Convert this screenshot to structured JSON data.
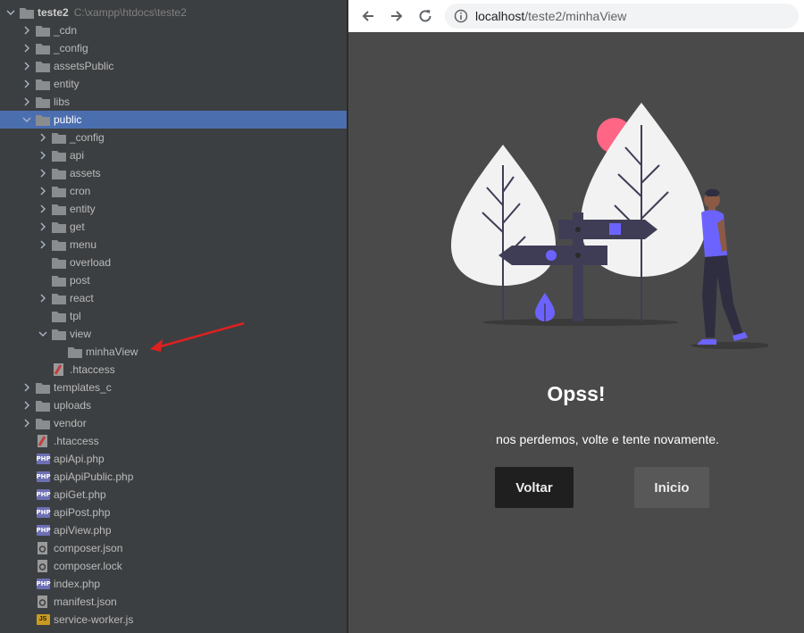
{
  "project_tree": {
    "root": {
      "name": "teste2",
      "path": "C:\\xampp\\htdocs\\teste2"
    },
    "items": [
      {
        "label": "_cdn",
        "depth": 1,
        "kind": "folder",
        "arrow": "collapsed"
      },
      {
        "label": "_config",
        "depth": 1,
        "kind": "folder",
        "arrow": "collapsed"
      },
      {
        "label": "assetsPublic",
        "depth": 1,
        "kind": "folder",
        "arrow": "collapsed"
      },
      {
        "label": "entity",
        "depth": 1,
        "kind": "folder",
        "arrow": "collapsed"
      },
      {
        "label": "libs",
        "depth": 1,
        "kind": "folder",
        "arrow": "collapsed"
      },
      {
        "label": "public",
        "depth": 1,
        "kind": "folder",
        "arrow": "expanded",
        "selected": true
      },
      {
        "label": "_config",
        "depth": 2,
        "kind": "folder",
        "arrow": "collapsed"
      },
      {
        "label": "api",
        "depth": 2,
        "kind": "folder",
        "arrow": "collapsed"
      },
      {
        "label": "assets",
        "depth": 2,
        "kind": "folder",
        "arrow": "collapsed"
      },
      {
        "label": "cron",
        "depth": 2,
        "kind": "folder",
        "arrow": "collapsed"
      },
      {
        "label": "entity",
        "depth": 2,
        "kind": "folder",
        "arrow": "collapsed"
      },
      {
        "label": "get",
        "depth": 2,
        "kind": "folder",
        "arrow": "collapsed"
      },
      {
        "label": "menu",
        "depth": 2,
        "kind": "folder",
        "arrow": "collapsed"
      },
      {
        "label": "overload",
        "depth": 2,
        "kind": "folder",
        "arrow": "none"
      },
      {
        "label": "post",
        "depth": 2,
        "kind": "folder",
        "arrow": "none"
      },
      {
        "label": "react",
        "depth": 2,
        "kind": "folder",
        "arrow": "collapsed"
      },
      {
        "label": "tpl",
        "depth": 2,
        "kind": "folder",
        "arrow": "none"
      },
      {
        "label": "view",
        "depth": 2,
        "kind": "folder",
        "arrow": "expanded"
      },
      {
        "label": "minhaView",
        "depth": 3,
        "kind": "folder",
        "arrow": "none"
      },
      {
        "label": ".htaccess",
        "depth": 2,
        "kind": "htaccess",
        "arrow": "none"
      },
      {
        "label": "templates_c",
        "depth": 1,
        "kind": "folder",
        "arrow": "collapsed"
      },
      {
        "label": "uploads",
        "depth": 1,
        "kind": "folder",
        "arrow": "collapsed"
      },
      {
        "label": "vendor",
        "depth": 1,
        "kind": "folder",
        "arrow": "collapsed"
      },
      {
        "label": ".htaccess",
        "depth": 1,
        "kind": "htaccess",
        "arrow": "none"
      },
      {
        "label": "apiApi.php",
        "depth": 1,
        "kind": "php",
        "arrow": "none"
      },
      {
        "label": "apiApiPublic.php",
        "depth": 1,
        "kind": "php",
        "arrow": "none"
      },
      {
        "label": "apiGet.php",
        "depth": 1,
        "kind": "php",
        "arrow": "none"
      },
      {
        "label": "apiPost.php",
        "depth": 1,
        "kind": "php",
        "arrow": "none"
      },
      {
        "label": "apiView.php",
        "depth": 1,
        "kind": "php",
        "arrow": "none"
      },
      {
        "label": "composer.json",
        "depth": 1,
        "kind": "json",
        "arrow": "none"
      },
      {
        "label": "composer.lock",
        "depth": 1,
        "kind": "json",
        "arrow": "none"
      },
      {
        "label": "index.php",
        "depth": 1,
        "kind": "php",
        "arrow": "none"
      },
      {
        "label": "manifest.json",
        "depth": 1,
        "kind": "json",
        "arrow": "none"
      },
      {
        "label": "service-worker.js",
        "depth": 1,
        "kind": "js",
        "arrow": "none"
      }
    ],
    "icon_labels": {
      "php": "PHP",
      "js": "JS"
    }
  },
  "browser": {
    "nav": {
      "back_icon": "arrow-left-icon",
      "forward_icon": "arrow-right-icon",
      "reload_icon": "reload-icon"
    },
    "url": {
      "host": "localhost",
      "path": "/teste2/minhaView"
    }
  },
  "page": {
    "title": "Opss!",
    "message": "nos perdemos, volte e tente novamente.",
    "buttons": {
      "back": "Voltar",
      "home": "Inicio"
    }
  },
  "colors": {
    "tree_bg": "#3c3f41",
    "tree_selected": "#4b6eaf",
    "folder": "#8a8d90",
    "page_bg": "#4a4a4a",
    "accent": "#6c63ff",
    "sun": "#ff6584",
    "arrow": "#e02020"
  }
}
